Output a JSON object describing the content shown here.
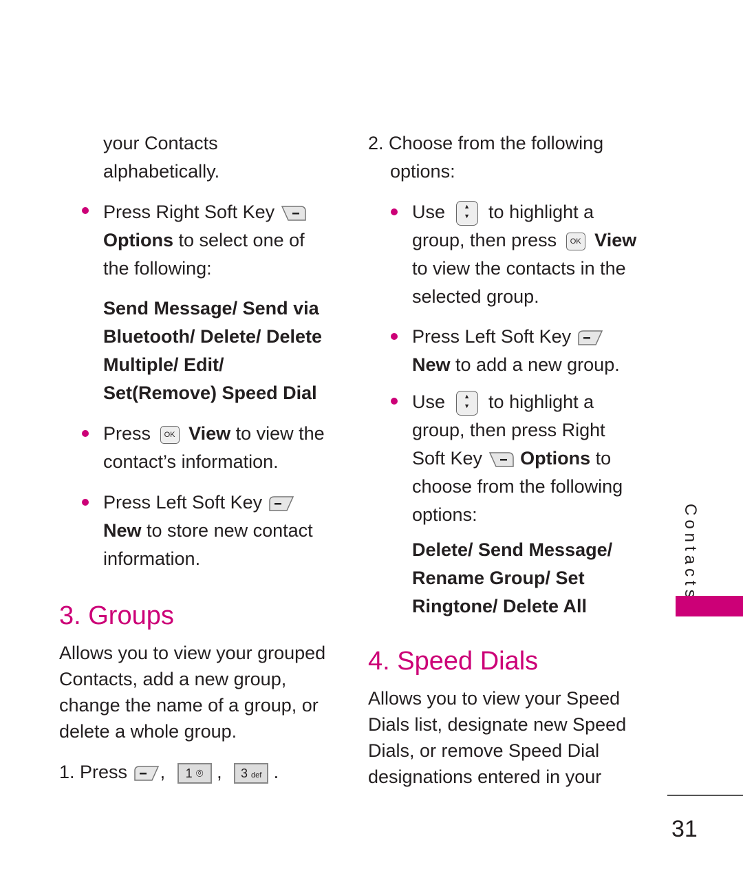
{
  "left": {
    "intro": [
      "your Contacts",
      "alphabetically."
    ],
    "bullet1": {
      "pre": "Press Right Soft Key",
      "bold": "Options",
      "post": " to select one of",
      "line3": "the following:"
    },
    "options_list": [
      "Send Message/ Send via",
      "Bluetooth/ Delete/ Delete",
      "Multiple/ Edit/",
      "Set(Remove) Speed Dial"
    ],
    "bullet2": {
      "pre": "Press",
      "bold": "View",
      "post": " to view the",
      "line2": "contact’s information."
    },
    "bullet3": {
      "pre": "Press Left Soft Key",
      "bold": "New",
      "post": " to store new contact",
      "line3": "information."
    },
    "section_title": "3. Groups",
    "section_body": [
      "Allows you to view your grouped",
      "Contacts, add a new group,",
      "change the name of a group, or",
      "delete a whole group."
    ],
    "step1": {
      "pre": "1. Press",
      "sep1": ",",
      "key1": "1",
      "sep2": ",",
      "key2": "3",
      "key2_sub": "def",
      "end": "."
    }
  },
  "right": {
    "step2": [
      "2. Choose from the following",
      "options:"
    ],
    "bullet1": {
      "pre": "Use",
      "post": "to highlight a",
      "line2_pre": "group, then press",
      "line2_bold": "View",
      "line3": "to view the contacts in the",
      "line4": "selected group."
    },
    "bullet2": {
      "pre": "Press Left Soft Key",
      "bold": "New",
      "post": " to add a new group."
    },
    "bullet3": {
      "pre": "Use",
      "post": "to highlight a",
      "line2": "group, then press Right",
      "line3_pre": "Soft Key",
      "line3_bold": "Options",
      "line3_post": " to",
      "line4": "choose from the following",
      "line5": "options:"
    },
    "options_list": [
      "Delete/ Send Message/",
      "Rename Group/ Set",
      "Ringtone/ Delete All"
    ],
    "section_title": "4. Speed Dials",
    "section_body": [
      "Allows you to view your Speed",
      "Dials list, designate new Speed",
      "Dials, or remove Speed Dial",
      "designations entered in your"
    ]
  },
  "side_tab": "Contacts",
  "page_number": "31",
  "icons": {
    "ok": "OK"
  },
  "colors": {
    "accent": "#cc0077"
  }
}
